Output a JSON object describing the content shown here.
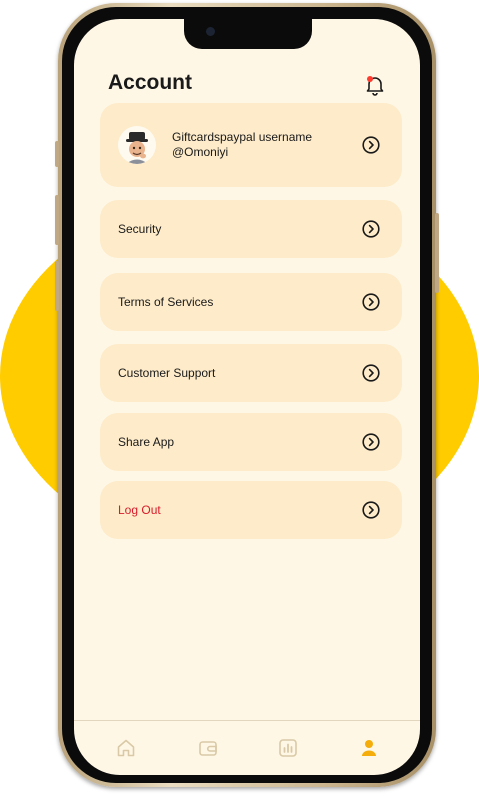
{
  "header": {
    "title": "Account"
  },
  "profile": {
    "name": "Giftcardspaypal username",
    "handle": "@Omoniyi"
  },
  "menu": [
    {
      "label": "Security"
    },
    {
      "label": "Terms of Services"
    },
    {
      "label": "Customer Support"
    },
    {
      "label": "Share App"
    },
    {
      "label": "Log Out"
    }
  ],
  "nav": [
    {
      "icon": "home-icon"
    },
    {
      "icon": "wallet-icon"
    },
    {
      "icon": "chart-icon"
    },
    {
      "icon": "user-icon"
    }
  ],
  "colors": {
    "screen_bg": "#fff7e6",
    "card_bg": "#fdebc9",
    "accent_yellow": "#ffcc00",
    "logout_red": "#d81b2a",
    "nav_active": "#f4ad0a",
    "nav_inactive": "#d9c9a6"
  }
}
